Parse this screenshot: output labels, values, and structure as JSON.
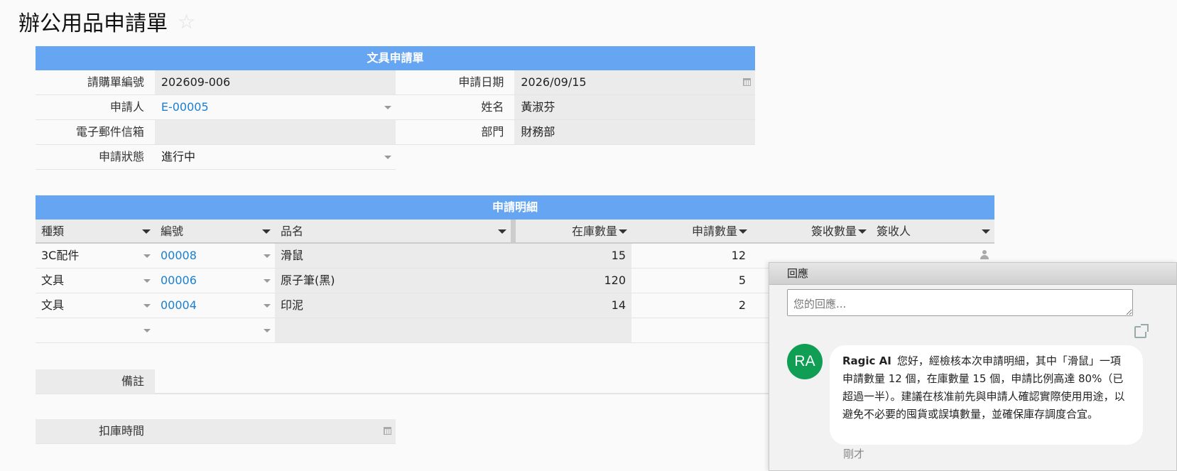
{
  "page": {
    "title": "辦公用品申請單",
    "star_icon": "star-icon"
  },
  "form": {
    "section_title": "文具申請單",
    "fields": {
      "order_no": {
        "label": "請購單編號",
        "value": "202609-006"
      },
      "apply_date": {
        "label": "申請日期",
        "value": "2026/09/15"
      },
      "applicant": {
        "label": "申請人",
        "value": "E-00005"
      },
      "name": {
        "label": "姓名",
        "value": "黃淑芬"
      },
      "email": {
        "label": "電子郵件信箱",
        "value": ""
      },
      "dept": {
        "label": "部門",
        "value": "財務部"
      },
      "status": {
        "label": "申請狀態",
        "value": "進行中"
      }
    }
  },
  "detail": {
    "section_title": "申請明細",
    "columns": [
      "種類",
      "編號",
      "品名",
      "在庫數量",
      "申請數量",
      "簽收數量",
      "簽收人"
    ],
    "rows": [
      {
        "type": "3C配件",
        "code": "00008",
        "item": "滑鼠",
        "stock": "15",
        "qty": "12"
      },
      {
        "type": "文具",
        "code": "00006",
        "item": "原子筆(黑)",
        "stock": "120",
        "qty": "5"
      },
      {
        "type": "文具",
        "code": "00004",
        "item": "印泥",
        "stock": "14",
        "qty": "2"
      }
    ]
  },
  "remark": {
    "label": "備註",
    "value": ""
  },
  "deduct_time": {
    "label": "扣庫時間",
    "value": ""
  },
  "comments": {
    "title": "回應",
    "placeholder": "您的回應...",
    "items": [
      {
        "avatar": "RA",
        "author": "Ragic AI",
        "text": "您好，經檢核本次申請明細，其中「滑鼠」一項申請數量 12 個，在庫數量 15 個，申請比例高達 80%（已超過一半）。建議在核准前先與申請人確認實際使用用途，以避免不必要的囤貨或誤填數量，並確保庫存調度合宜。",
        "time": "剛才"
      }
    ]
  },
  "colors": {
    "header_blue": "#66a5f1",
    "link_blue": "#1a7fd1",
    "avatar_green": "#109e55"
  }
}
